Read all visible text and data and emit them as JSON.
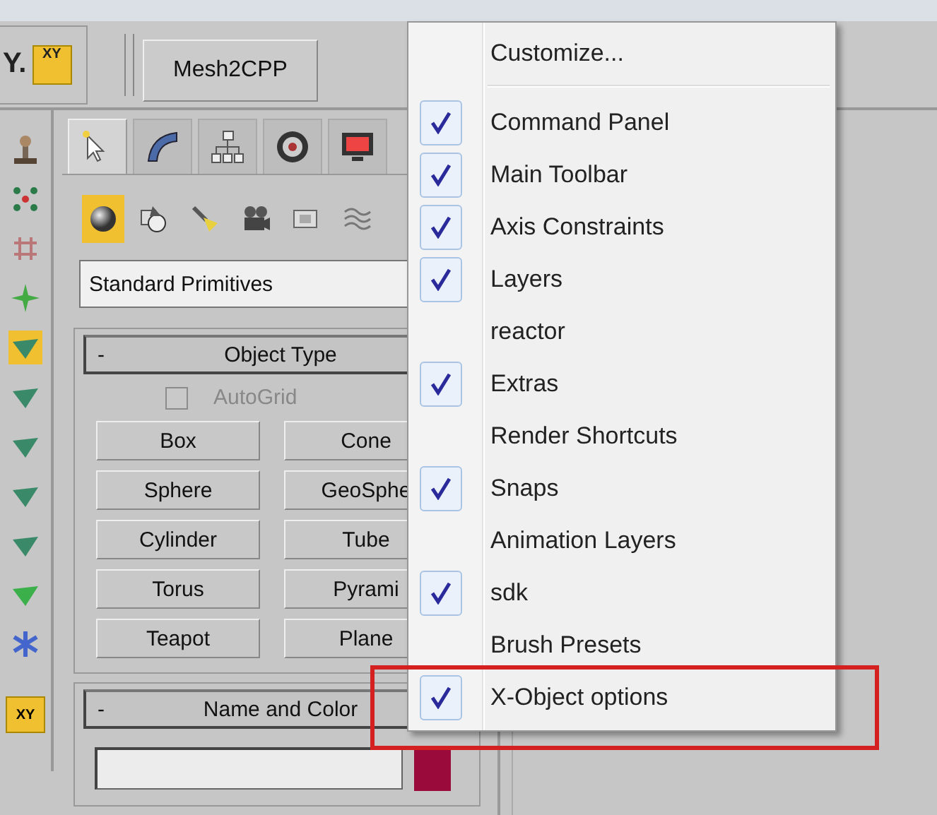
{
  "toolbar": {
    "axis_label": "Y.",
    "axis_button": "XY",
    "plugin_button": "Mesh2CPP"
  },
  "left_toolbar": {
    "bottom_button": "XY"
  },
  "command_panel": {
    "tabs": [
      {
        "selected": true
      },
      {
        "selected": false
      },
      {
        "selected": false
      },
      {
        "selected": false
      },
      {
        "selected": false
      }
    ],
    "categories": [
      {
        "selected": true
      },
      {
        "selected": false
      },
      {
        "selected": false
      },
      {
        "selected": false
      },
      {
        "selected": false
      },
      {
        "selected": false
      }
    ],
    "dropdown": "Standard Primitives",
    "object_type": {
      "collapse": "-",
      "title": "Object Type",
      "autogrid": {
        "label": "AutoGrid",
        "checked": false,
        "disabled": true
      },
      "buttons": [
        "Box",
        "Cone",
        "Sphere",
        "GeoSphe",
        "Cylinder",
        "Tube",
        "Torus",
        "Pyrami",
        "Teapot",
        "Plane"
      ]
    },
    "name_and_color": {
      "collapse": "-",
      "title": "Name and Color",
      "color": "#9a0a3a"
    }
  },
  "context_menu": {
    "items": [
      {
        "kind": "command",
        "label": "Customize..."
      },
      {
        "kind": "separator"
      },
      {
        "kind": "toggle",
        "label": "Command Panel",
        "checked": true
      },
      {
        "kind": "toggle",
        "label": "Main Toolbar",
        "checked": true
      },
      {
        "kind": "toggle",
        "label": "Axis Constraints",
        "checked": true
      },
      {
        "kind": "toggle",
        "label": "Layers",
        "checked": true
      },
      {
        "kind": "toggle",
        "label": "reactor",
        "checked": false
      },
      {
        "kind": "toggle",
        "label": "Extras",
        "checked": true
      },
      {
        "kind": "toggle",
        "label": "Render Shortcuts",
        "checked": false
      },
      {
        "kind": "toggle",
        "label": "Snaps",
        "checked": true
      },
      {
        "kind": "toggle",
        "label": "Animation Layers",
        "checked": false
      },
      {
        "kind": "toggle",
        "label": "sdk",
        "checked": true
      },
      {
        "kind": "toggle",
        "label": "Brush Presets",
        "checked": false
      },
      {
        "kind": "toggle",
        "label": "X-Object options",
        "checked": true,
        "highlighted": true
      }
    ]
  }
}
